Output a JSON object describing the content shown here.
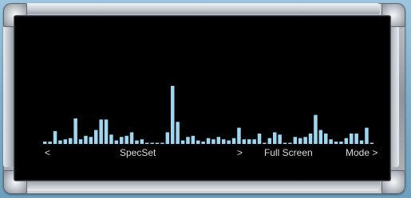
{
  "controls": {
    "prev_label": "<",
    "preset_label": "SpecSet",
    "next_label": ">",
    "fullscreen_label": "Full Screen",
    "mode_label": "Mode >"
  },
  "colors": {
    "screen_background": "#000000",
    "bar_color": "#9fd6ef",
    "label_color": "#dcdcdc",
    "frame_metal": "#b8bec4",
    "desktop_background": "#8ab4cf"
  },
  "spectrum": {
    "levels": [
      0.04,
      0.04,
      0.22,
      0.06,
      0.08,
      0.1,
      0.44,
      0.08,
      0.14,
      0.12,
      0.24,
      0.42,
      0.42,
      0.16,
      0.06,
      0.12,
      0.14,
      0.2,
      0.06,
      0.08,
      0.02,
      0.02,
      0.02,
      0.02,
      0.2,
      1.0,
      0.38,
      0.06,
      0.12,
      0.14,
      0.06,
      0.04,
      0.1,
      0.08,
      0.12,
      0.08,
      0.06,
      0.1,
      0.28,
      0.08,
      0.08,
      0.08,
      0.18,
      0.02,
      0.1,
      0.2,
      0.16,
      0.02,
      0.02,
      0.12,
      0.1,
      0.12,
      0.18,
      0.5,
      0.24,
      0.18,
      0.08,
      0.04,
      0.04,
      0.1,
      0.18,
      0.18,
      0.06,
      0.28,
      0.02
    ]
  }
}
